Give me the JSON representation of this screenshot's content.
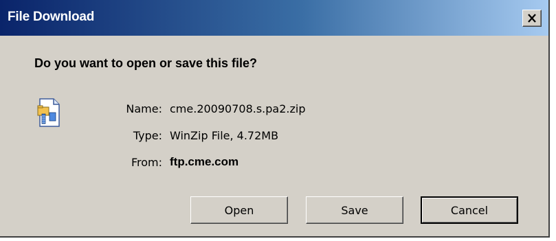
{
  "window": {
    "title": "File Download",
    "close_glyph": "✕",
    "close_icon": "close-icon"
  },
  "prompt": {
    "question": "Do you want to open or save this file?"
  },
  "file": {
    "icon": "zip-file-icon",
    "name_label": "Name:",
    "name_value": "cme.20090708.s.pa2.zip",
    "type_label": "Type:",
    "type_value": "WinZip File, 4.72MB",
    "from_label": "From:",
    "from_value": "ftp.cme.com"
  },
  "buttons": {
    "open_label": "Open",
    "save_label": "Save",
    "cancel_label": "Cancel"
  },
  "colors": {
    "titlebar_start": "#0a246a",
    "titlebar_end": "#a6caf0",
    "face": "#d4d0c8"
  }
}
